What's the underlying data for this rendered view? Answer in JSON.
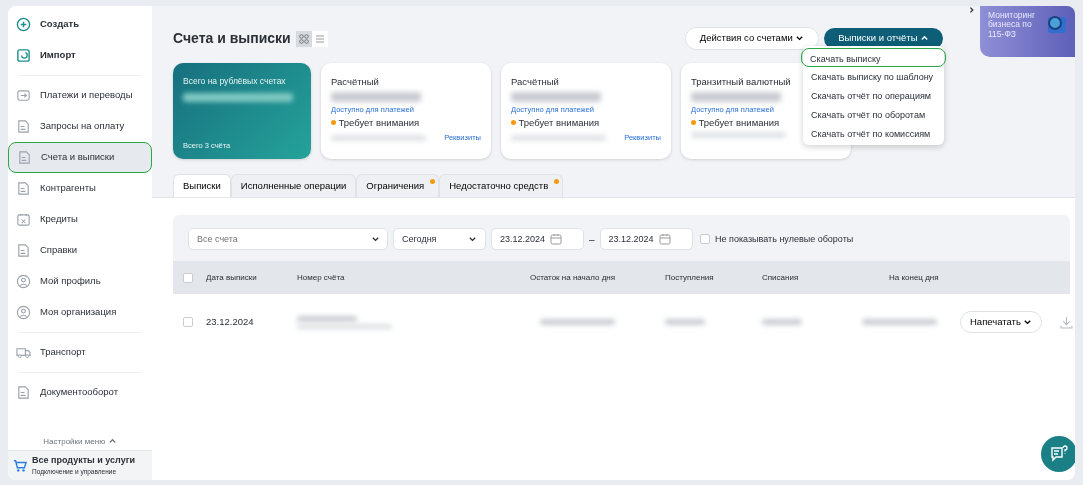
{
  "sidebar": {
    "sections": [
      [
        {
          "label": "Создать",
          "kind": "create",
          "selected": false
        },
        {
          "label": "Импорт",
          "kind": "import",
          "selected": false
        }
      ],
      [
        {
          "label": "Платежи и переводы",
          "kind": "transfer",
          "selected": false
        },
        {
          "label": "Запросы на оплату",
          "kind": "document",
          "selected": false
        },
        {
          "label": "Счета и выписки",
          "kind": "document",
          "selected": true
        },
        {
          "label": "Контрагенты",
          "kind": "document",
          "selected": false
        },
        {
          "label": "Кредиты",
          "kind": "calendar",
          "selected": false
        },
        {
          "label": "Справки",
          "kind": "document",
          "selected": false
        },
        {
          "label": "Мой профиль",
          "kind": "person",
          "selected": false
        },
        {
          "label": "Моя организация",
          "kind": "person",
          "selected": false
        }
      ],
      [
        {
          "label": "Транспорт",
          "kind": "transport",
          "selected": false
        }
      ],
      [
        {
          "label": "Документооборот",
          "kind": "document",
          "selected": false
        }
      ]
    ],
    "settings": "Настройки меню",
    "products": {
      "title": "Все продукты и услуги",
      "subtitle": "Подключение и управление"
    }
  },
  "header": {
    "title": "Счета и выписки",
    "views": [
      {
        "kind": "grid",
        "selected": true
      },
      {
        "kind": "list",
        "selected": false
      }
    ],
    "actions_button": "Действия со счетами",
    "reports_button": {
      "label": "Выписки и отчёты",
      "expanded": true
    },
    "reports_menu": [
      {
        "label": "Скачать выписку",
        "selected": true
      },
      {
        "label": "Скачать выписку по шаблону",
        "selected": false
      },
      {
        "label": "Скачать отчёт по операциям",
        "selected": false
      },
      {
        "label": "Скачать отчёт по оборотам",
        "selected": false
      },
      {
        "label": "Скачать отчёт по комиссиям",
        "selected": false
      }
    ]
  },
  "promo": {
    "text": "Мониторинг бизнеса по 115-ФЗ"
  },
  "summary_card": {
    "label": "Всего на рублёвых счетах",
    "footer": "Всего 3 счёта"
  },
  "accounts": [
    {
      "type": "Расчётный",
      "available": "Доступно для платежей",
      "status": "Требует внимания",
      "details_link": "Реквизиты"
    },
    {
      "type": "Расчётный",
      "available": "Доступно для платежей",
      "status": "Требует внимания",
      "details_link": "Реквизиты"
    },
    {
      "type": "Транзитный валютный",
      "available": "Доступно для платежей",
      "status": "Требует внимания"
    }
  ],
  "tabs": [
    {
      "label": "Выписки",
      "selected": true,
      "dot": false
    },
    {
      "label": "Исполненные операции",
      "selected": false,
      "dot": false
    },
    {
      "label": "Ограничения",
      "selected": false,
      "dot": true
    },
    {
      "label": "Недостаточно средств",
      "selected": false,
      "dot": true
    }
  ],
  "filters": {
    "account": {
      "placeholder": "Все счета"
    },
    "period": "Сегодня",
    "date_from": "23.12.2024",
    "date_to": "23.12.2024",
    "dash": "–",
    "hide_zero": {
      "label": "Не показывать нулевые обороты",
      "checked": false
    }
  },
  "table": {
    "select_all_checked": false,
    "columns": [
      "Дата выписки",
      "Номер счёта",
      "Остаток на начало дня",
      "Поступления",
      "Списания",
      "На конец дня"
    ],
    "rows": [
      {
        "date": "23.12.2024",
        "checked": false,
        "print_button": "Напечатать"
      }
    ]
  }
}
